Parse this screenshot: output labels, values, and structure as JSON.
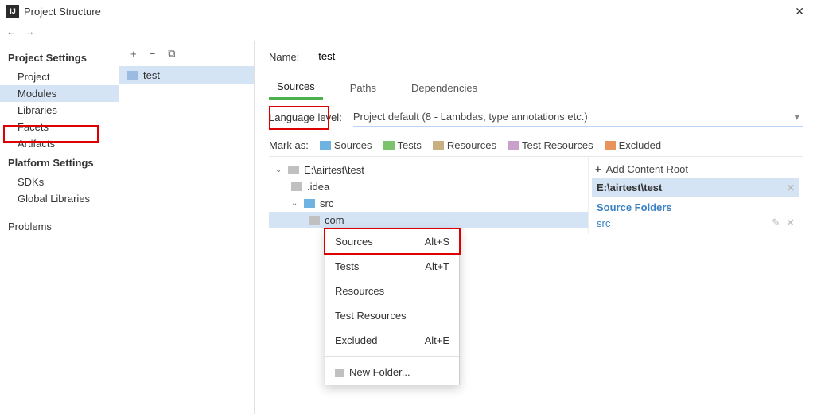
{
  "title": "Project Structure",
  "sidebar": {
    "group1_label": "Project Settings",
    "items1": [
      "Project",
      "Modules",
      "Libraries",
      "Facets",
      "Artifacts"
    ],
    "group2_label": "Platform Settings",
    "items2": [
      "SDKs",
      "Global Libraries"
    ],
    "problems": "Problems"
  },
  "modules": {
    "item": "test"
  },
  "main": {
    "name_label": "Name:",
    "name_value": "test",
    "tabs": [
      "Sources",
      "Paths",
      "Dependencies"
    ],
    "lang_label": "Language level:",
    "lang_value": "Project default (8 - Lambdas, type annotations etc.)",
    "mark_label": "Mark as:",
    "marks": [
      {
        "label": "Sources",
        "color": "#6fb3e0"
      },
      {
        "label": "Tests",
        "color": "#7cc36e"
      },
      {
        "label": "Resources",
        "color": "#c8b082"
      },
      {
        "label": "Test Resources",
        "color": "#c9a0c9"
      },
      {
        "label": "Excluded",
        "color": "#e8925c"
      }
    ]
  },
  "tree": {
    "root": "E:\\airtest\\test",
    "idea": ".idea",
    "src": "src",
    "com": "com"
  },
  "menu": {
    "items": [
      {
        "label": "Sources",
        "shortcut": "Alt+S"
      },
      {
        "label": "Tests",
        "shortcut": "Alt+T"
      },
      {
        "label": "Resources",
        "shortcut": ""
      },
      {
        "label": "Test Resources",
        "shortcut": ""
      },
      {
        "label": "Excluded",
        "shortcut": "Alt+E"
      }
    ],
    "new_folder": "New Folder..."
  },
  "roots": {
    "add_label": "Add Content Root",
    "path": "E:\\airtest\\test",
    "source_folders_label": "Source Folders",
    "src": "src"
  }
}
